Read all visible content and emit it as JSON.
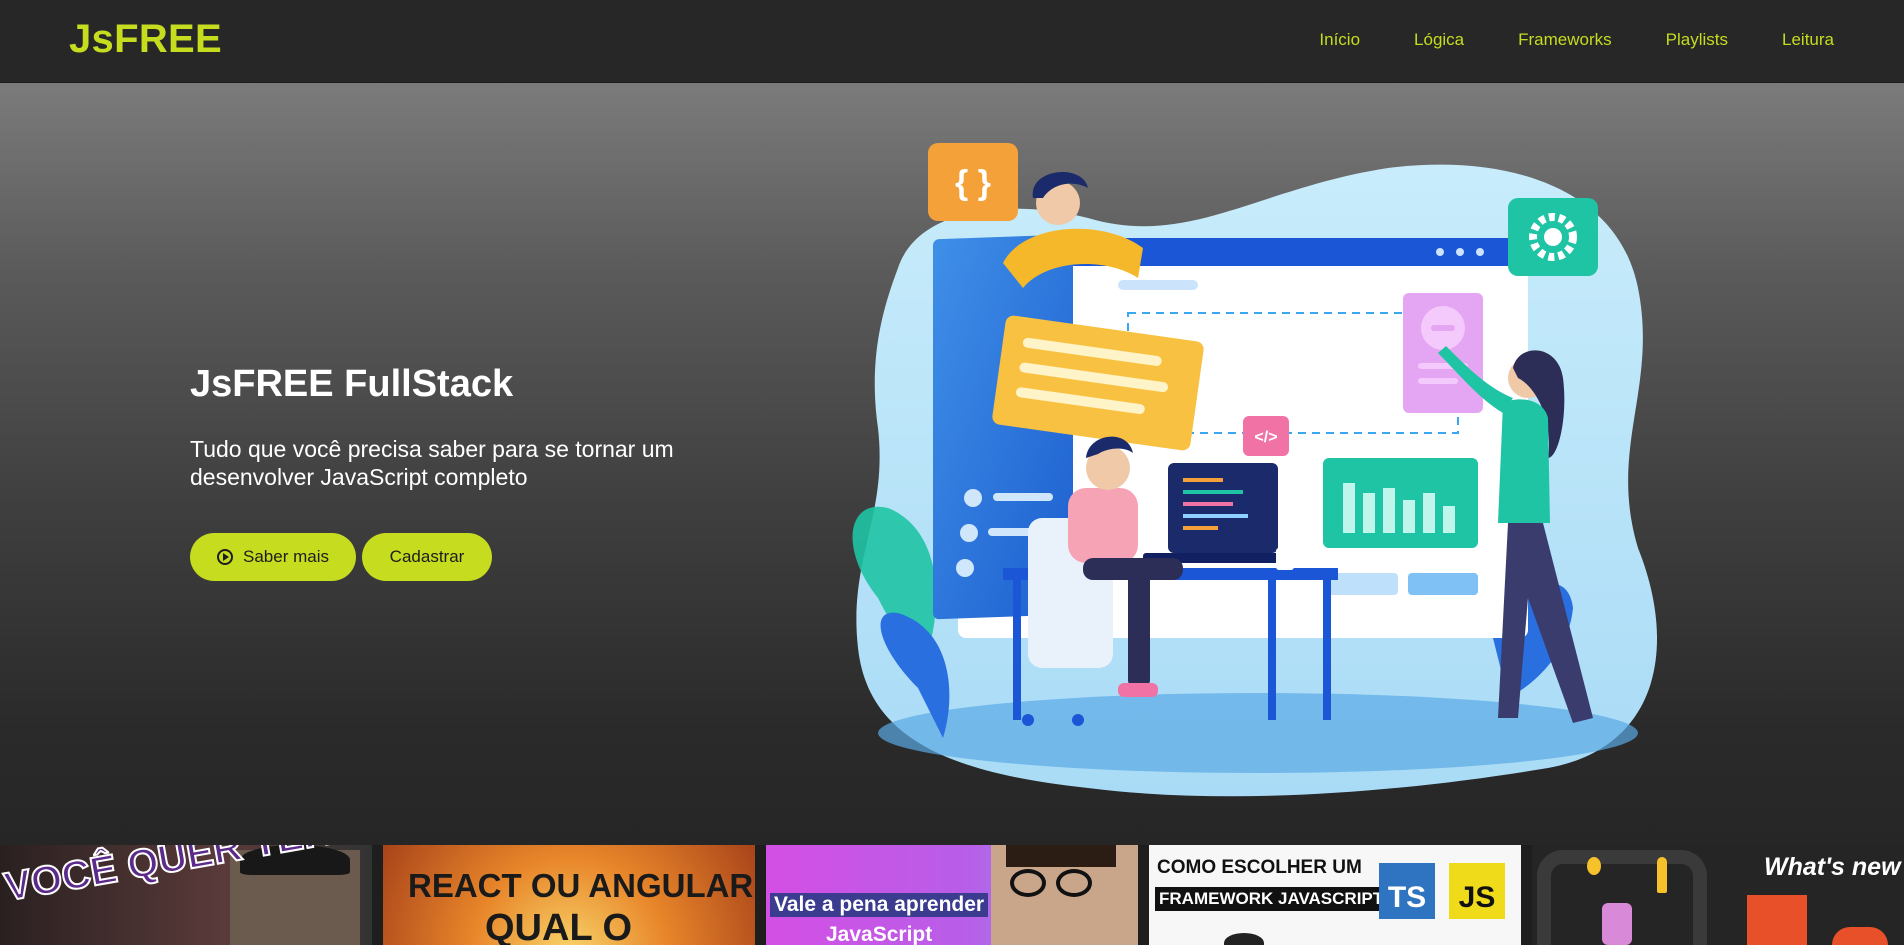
{
  "brand": {
    "logo": "JsFREE",
    "accent": "#c5dc1f"
  },
  "nav": {
    "items": [
      {
        "label": "Início"
      },
      {
        "label": "Lógica"
      },
      {
        "label": "Frameworks"
      },
      {
        "label": "Playlists"
      },
      {
        "label": "Leitura"
      }
    ]
  },
  "hero": {
    "title": "JsFREE FullStack",
    "subtitle": "Tudo que você precisa saber para se tornar um desenvolver JavaScript completo",
    "primary_button": "Saber mais",
    "secondary_button": "Cadastrar",
    "illustration_code_icon": "{ }",
    "illustration_tag_icon": "</>"
  },
  "thumbnails": [
    {
      "text": "VOCÊ QUER TER SUCESSO"
    },
    {
      "line1": "REACT OU ANGULAR?",
      "line2": "QUAL O"
    },
    {
      "line1": "Vale a pena aprender",
      "line2": "JavaScript"
    },
    {
      "line1": "COMO ESCOLHER UM",
      "line2": "FRAMEWORK JAVASCRIPT?",
      "badge1": "TS",
      "badge2": "JS"
    },
    {
      "text": "What's new"
    }
  ]
}
